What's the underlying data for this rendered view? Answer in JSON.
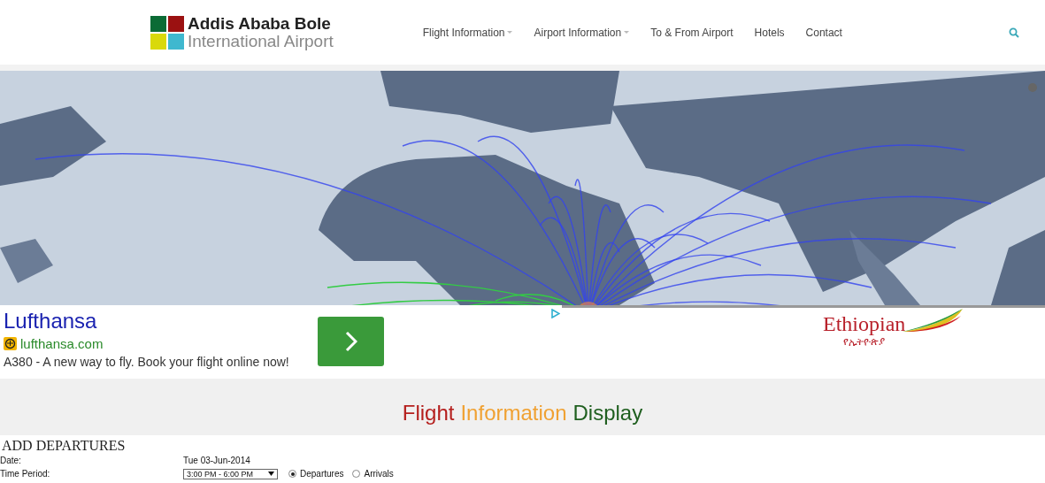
{
  "header": {
    "logo": {
      "line1": "Addis Ababa Bole",
      "line2": "International Airport"
    },
    "nav": [
      {
        "label": "Flight Information",
        "dropdown": true
      },
      {
        "label": "Airport Information",
        "dropdown": true
      },
      {
        "label": "To & From Airport",
        "dropdown": false
      },
      {
        "label": "Hotels",
        "dropdown": false
      },
      {
        "label": "Contact",
        "dropdown": false
      }
    ]
  },
  "ad": {
    "title": "Lufthansa",
    "url": "lufthansa.com",
    "text": "A380 - A new way to fly. Book your flight online now!",
    "sponsor": {
      "name": "Ethiopian",
      "script": "የኢትዮጵያ"
    }
  },
  "section": {
    "title": [
      {
        "text": "Flight",
        "color": "#b5201e"
      },
      {
        "text": "Information",
        "color": "#f0a132"
      },
      {
        "text": "Display",
        "color": "#1f5f1f"
      }
    ],
    "heading": "ADD DEPARTURES",
    "fields": [
      {
        "kind": "text",
        "label": "Date:",
        "value": "Tue 03-Jun-2014"
      },
      {
        "kind": "select",
        "label": "Time Period:",
        "value": "3:00 PM - 6:00 PM",
        "options": [
          {
            "label": "Departures",
            "selected": true
          },
          {
            "label": "Arrivals",
            "selected": false
          }
        ]
      }
    ]
  }
}
